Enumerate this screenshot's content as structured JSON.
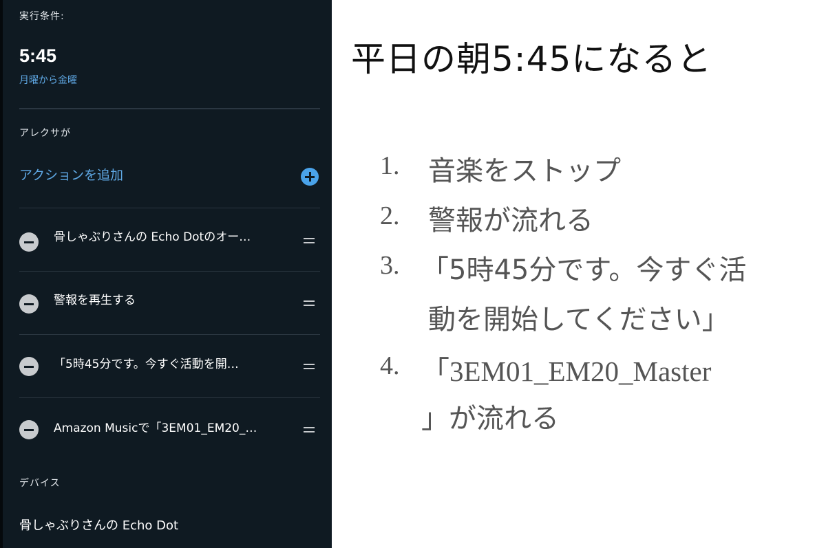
{
  "panel": {
    "trigger_label": "実行条件:",
    "time": "5:45",
    "days": "月曜から金曜",
    "actions_label": "アレクサが",
    "add_action": "アクションを追加",
    "actions": [
      {
        "text": "骨しゃぶりさんの Echo Dotのオー…"
      },
      {
        "text": "警報を再生する"
      },
      {
        "text": "「5時45分です。今すぐ活動を開…"
      },
      {
        "text": "Amazon Musicで「3EM01_EM20_…"
      }
    ],
    "device_label": "デバイス",
    "device_name": "骨しゃぶりさんの Echo Dot"
  },
  "annotation": {
    "heading": "平日の朝5:45になると",
    "steps": [
      {
        "num": "1.",
        "lines": [
          "音楽をストップ"
        ]
      },
      {
        "num": "2.",
        "lines": [
          "警報が流れる"
        ]
      },
      {
        "num": "3.",
        "lines": [
          "「5時45分です。今すぐ活",
          "動を開始してください」"
        ]
      },
      {
        "num": "4.",
        "lines": [
          "「3EM01_EM20_Master",
          "」が流れる"
        ]
      }
    ]
  },
  "colors": {
    "panel_bg": "#0f1a22",
    "accent": "#5fa8e4",
    "add_button": "#4aa3ea"
  }
}
